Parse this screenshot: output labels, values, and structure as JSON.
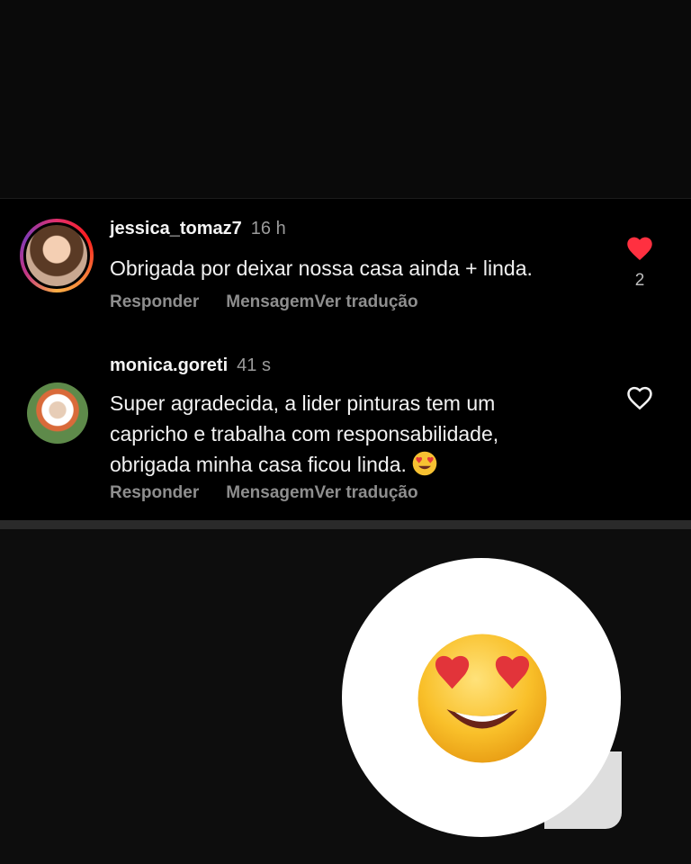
{
  "comments": [
    {
      "username": "jessica_tomaz7",
      "time": "16 h",
      "text": "Obrigada por deixar nossa casa ainda + linda.",
      "liked": true,
      "like_count": "2",
      "reply_label": "Responder",
      "message_label": "MensagemVer tradução"
    },
    {
      "username": "monica.goreti",
      "time": "41 s",
      "text": "Super agradecida, a lider pinturas tem um capricho e trabalha com responsabilidade, obrigada minha casa ficou linda.",
      "liked": false,
      "reply_label": "Responder",
      "message_label": "MensagemVer tradução"
    }
  ],
  "colors": {
    "heart_red": "#ff3040",
    "background": "#000000",
    "muted_text": "#8e8e8e"
  },
  "icons": {
    "like_filled": "heart-filled-icon",
    "like_outline": "heart-outline-icon",
    "emoji": "heart-eyes-emoji"
  }
}
